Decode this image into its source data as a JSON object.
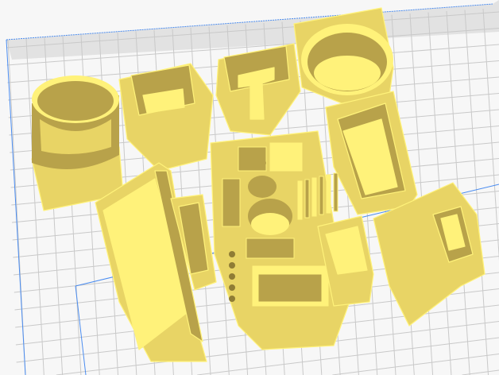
{
  "viewport": {
    "colors": {
      "background": "#f7f7f7",
      "plate_edge": "#e2e2e2",
      "grid_line": "#c9c9c9",
      "border_line": "#4a8cf0",
      "model_light": "#fff27a",
      "model_mid": "#e8d465",
      "model_dark": "#b8a24a",
      "model_shadow": "#8f7c35"
    }
  }
}
